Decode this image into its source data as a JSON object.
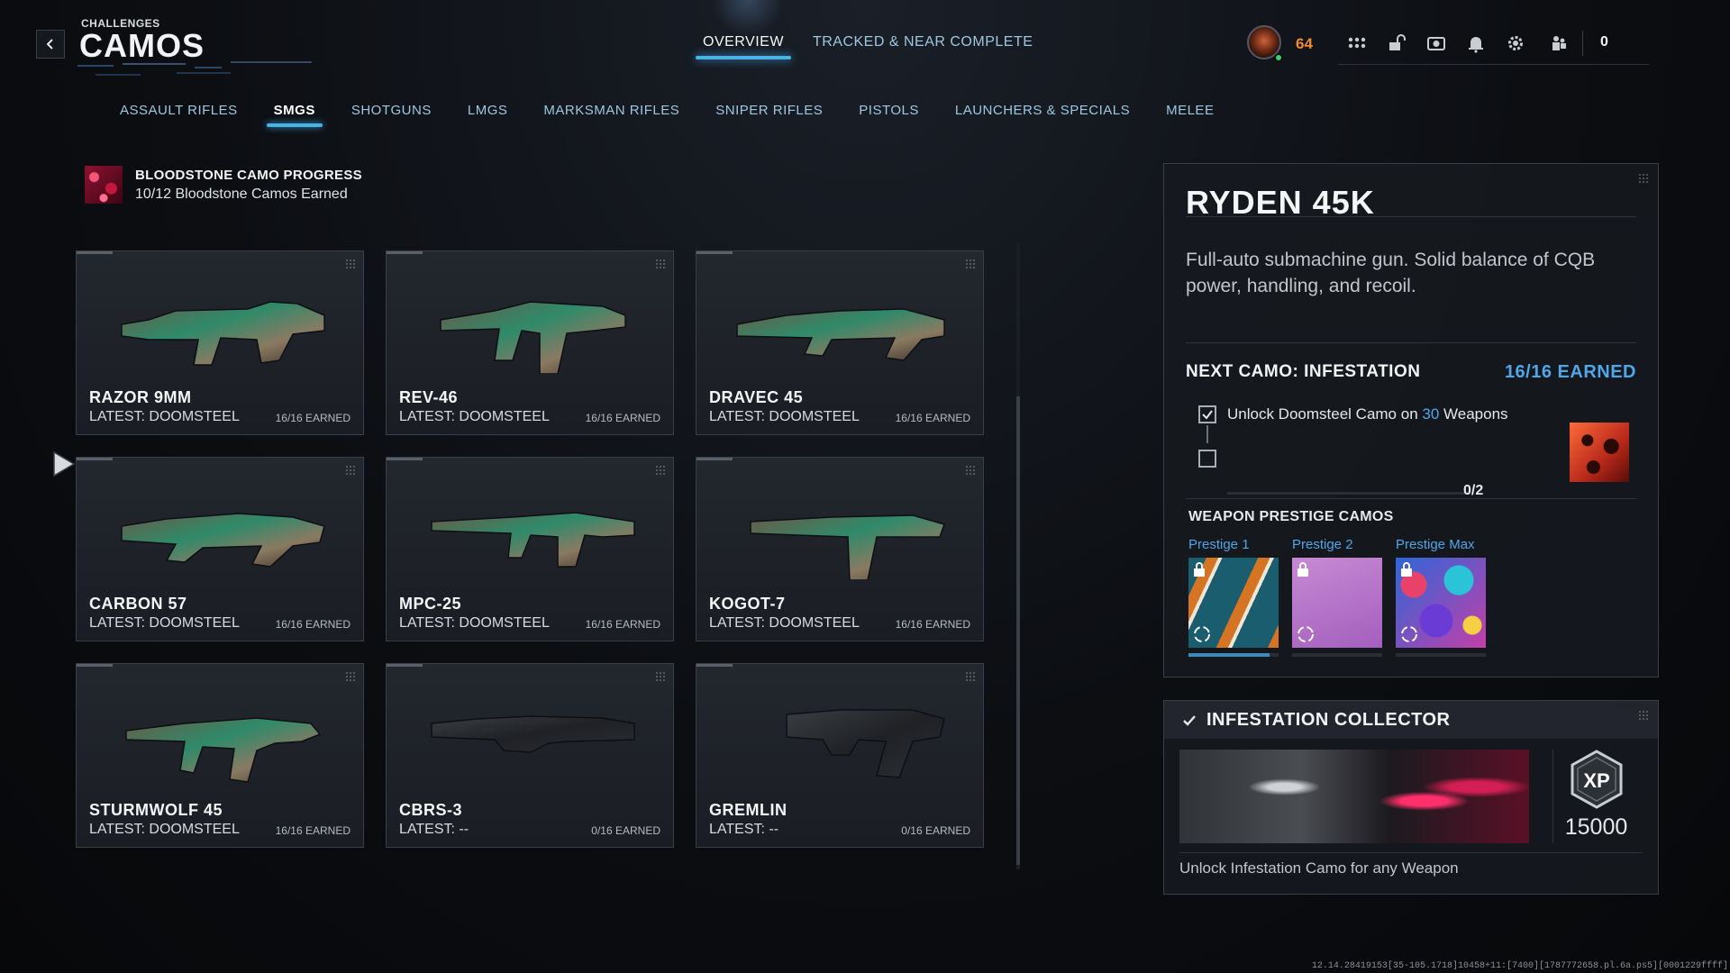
{
  "header": {
    "eyebrow": "CHALLENGES",
    "title": "CAMOS",
    "tabs": [
      {
        "label": "OVERVIEW",
        "active": true
      },
      {
        "label": "TRACKED & NEAR COMPLETE",
        "active": false
      }
    ]
  },
  "hud": {
    "level": "64",
    "icons": [
      "grid-icon",
      "unlock-icon",
      "camera-icon",
      "bell-icon",
      "gear-icon",
      "party-icon"
    ],
    "party_count": "0"
  },
  "categories": [
    {
      "label": "ASSAULT RIFLES",
      "active": false
    },
    {
      "label": "SMGS",
      "active": true
    },
    {
      "label": "SHOTGUNS",
      "active": false
    },
    {
      "label": "LMGS",
      "active": false
    },
    {
      "label": "MARKSMAN RIFLES",
      "active": false
    },
    {
      "label": "SNIPER RIFLES",
      "active": false
    },
    {
      "label": "PISTOLS",
      "active": false
    },
    {
      "label": "LAUNCHERS & SPECIALS",
      "active": false
    },
    {
      "label": "MELEE",
      "active": false
    }
  ],
  "progress": {
    "title": "BLOODSTONE CAMO PROGRESS",
    "subtitle": "10/12 Bloodstone Camos Earned"
  },
  "weapons": [
    {
      "name": "RAZOR 9MM",
      "latest": "LATEST: DOOMSTEEL",
      "earned": "16/16 EARNED",
      "camo": "green"
    },
    {
      "name": "REV-46",
      "latest": "LATEST: DOOMSTEEL",
      "earned": "16/16 EARNED",
      "camo": "green"
    },
    {
      "name": "DRAVEC 45",
      "latest": "LATEST: DOOMSTEEL",
      "earned": "16/16 EARNED",
      "camo": "green"
    },
    {
      "name": "CARBON 57",
      "latest": "LATEST: DOOMSTEEL",
      "earned": "16/16 EARNED",
      "camo": "green"
    },
    {
      "name": "MPC-25",
      "latest": "LATEST: DOOMSTEEL",
      "earned": "16/16 EARNED",
      "camo": "green"
    },
    {
      "name": "KOGOT-7",
      "latest": "LATEST: DOOMSTEEL",
      "earned": "16/16 EARNED",
      "camo": "green"
    },
    {
      "name": "STURMWOLF 45",
      "latest": "LATEST: DOOMSTEEL",
      "earned": "16/16 EARNED",
      "camo": "green"
    },
    {
      "name": "CBRS-3",
      "latest": "LATEST: --",
      "earned": "0/16 EARNED",
      "camo": "black"
    },
    {
      "name": "GREMLIN",
      "latest": "LATEST: --",
      "earned": "0/16 EARNED",
      "camo": "black"
    }
  ],
  "detail": {
    "weapon_name": "RYDEN 45K",
    "description": "Full-auto submachine gun. Solid balance of CQB power, handling, and recoil.",
    "next_camo_label": "NEXT CAMO: INFESTATION",
    "next_camo_earned": "16/16 EARNED",
    "requirement_prefix": "Unlock Doomsteel Camo on ",
    "requirement_number": "30",
    "requirement_suffix": " Weapons",
    "requirement_checked": true,
    "requirement_progress": "0/2",
    "prestige_heading": "WEAPON PRESTIGE CAMOS",
    "prestige": [
      {
        "label": "Prestige 1",
        "locked": true,
        "progress": 0.9
      },
      {
        "label": "Prestige 2",
        "locked": true,
        "progress": 0
      },
      {
        "label": "Prestige Max",
        "locked": true,
        "progress": 0
      }
    ]
  },
  "collector": {
    "title": "INFESTATION COLLECTOR",
    "completed": true,
    "xp_label": "XP",
    "xp_value": "15000",
    "description": "Unlock Infestation Camo for any Weapon"
  },
  "build_id": "12.14.28419153[35-105.1718]10458+11:[7400][1787772658.pl.6a.ps5][0001229ffff]"
}
